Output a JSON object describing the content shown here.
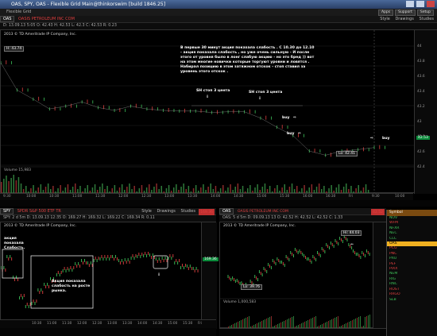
{
  "window": {
    "title": "OAS, SPY, OAS - Flexible Grid Main@thinkorswim [build 1846.25]",
    "menu_left": "Flexible Grid",
    "menu_buttons": [
      "Apps",
      "Support",
      "Setup"
    ]
  },
  "top_chart": {
    "symbol": "OAS",
    "company": "OASIS PETROLEUM INC COM",
    "style_label": "Style",
    "drawings_label": "Drawings",
    "studies_label": "Studies",
    "quote_line": "D: 13.09.13 5:05 O: 42.43  H: 42.53  L: 42.3  C: 42.53  R: 0.23",
    "agg_label": "2013 8 d 5m",
    "copyright": "2013 © TD Ameritrade IP Company, Inc.",
    "high_label": "H: 43.74",
    "low_label": "Lo: 42.41",
    "last_price": "42.53",
    "price_ticks": [
      "44",
      "43.8",
      "43.6",
      "43.4",
      "43.2",
      "43",
      "42.8",
      "42.6",
      "42.4"
    ],
    "time_ticks": [
      "9:30",
      "10:00",
      "10:30",
      "11:00",
      "11:30",
      "12:00",
      "12:30",
      "13:00",
      "13:30",
      "14:00",
      "14:30",
      "15:00",
      "15:30",
      "16:00",
      "16:30",
      "Fri",
      "9:30",
      "10:00"
    ],
    "volume_label": "Volume",
    "volume_value": "15,983",
    "annotation_main": "В первые 30 минут акция показала слабость . С 10.30 до 12.10 - акция показала слабость , но уже очень сильную - И после этого от уровня было в лонг слабую акцию - но это бред )) вот на этом многие новички которые торгуют уровни и ловятся . Набирал позицию в этом затяжном отскок - стоп ставил за уровень этого отскок .",
    "stop1": "SH стоп 3 цента",
    "stop2": "SH стоп 3 цента",
    "buy1": "buy",
    "buy2": "buy",
    "buy3": "buy",
    "chart_data": {
      "type": "line",
      "title": "",
      "xlabel": "",
      "ylabel": "",
      "ylim": [
        42.3,
        44.0
      ],
      "series": [
        {
          "values": [
            43.74,
            43.35,
            43.22,
            43.08,
            43.12,
            43.18,
            43.1,
            43.06,
            43.12,
            43.08,
            43.06,
            43.05,
            43.05,
            43.03,
            43.04,
            43.04,
            42.95,
            42.82,
            42.7,
            42.48,
            42.42,
            42.48,
            42.5,
            42.53
          ]
        }
      ]
    }
  },
  "bottom_left": {
    "symbol": "SPY",
    "company": "SPDR S&P 500 ETF TR",
    "style_label": "Style",
    "drawings_label": "Drawings",
    "studies_label": "Studies",
    "last_price_tag": "169.36",
    "quote_line": "SPY: 2 d 5m  D: 13.09.13 12:35  O: 169.27  H: 169.32  L: 169.22  C: 169.34  R: 0.11",
    "copyright": "2013 © TD Ameritrade IP Company, Inc.",
    "annotation1": "акция показала Слабость.",
    "annotation2": "Акция показала слабость на росте рынка.",
    "price_tag": "169.36",
    "time_ticks": [
      "10:30",
      "11:00",
      "11:30",
      "12:00",
      "12:30",
      "13:00",
      "13:30",
      "14:00",
      "14:30",
      "15:00",
      "15:30",
      "Fri"
    ]
  },
  "bottom_right": {
    "symbol": "OAS",
    "company": "OASIS PETROLEUM INC COM",
    "style_label": "Style",
    "drawings_label": "Drawings",
    "studies_label": "Studies",
    "last_price_tag": "42.52",
    "quote_line": "OAS: 5 d 5m  D: 09.09.13 13  O: 42.52  H: 42.52  L: 42.52  C: 1.33",
    "copyright": "2013 © TD Ameritrade IP Company, Inc.",
    "high_label": "Hi: 44.03",
    "low_label": "Lo: 39.76",
    "volume_label": "Volume",
    "volume_value": "1,000,583"
  },
  "watchlist": {
    "header": "Symbol",
    "items": [
      {
        "sym": "NOV",
        "cls": "g"
      },
      {
        "sym": "WFM",
        "cls": "r"
      },
      {
        "sym": "NFXR",
        "cls": "g"
      },
      {
        "sym": "NEC",
        "cls": "g"
      },
      {
        "sym": "CLC",
        "cls": "g"
      },
      {
        "sym": "OAS",
        "cls": "sel"
      },
      {
        "sym": "PCG",
        "cls": "r"
      },
      {
        "sym": "PNC",
        "cls": "r"
      },
      {
        "sym": "PXU",
        "cls": "g"
      },
      {
        "sym": "PEF",
        "cls": "r"
      },
      {
        "sym": "PIXX",
        "cls": "r"
      },
      {
        "sym": "NEM",
        "cls": "g"
      },
      {
        "sym": "RIG",
        "cls": "g"
      },
      {
        "sym": "RNC",
        "cls": "g"
      },
      {
        "sym": "ROST",
        "cls": "r"
      },
      {
        "sym": "RRGO",
        "cls": "r"
      },
      {
        "sym": "SLB",
        "cls": "g"
      }
    ]
  },
  "colors": {
    "up": "#3ec35a",
    "down": "#e04040",
    "accent": "#f0b020"
  }
}
